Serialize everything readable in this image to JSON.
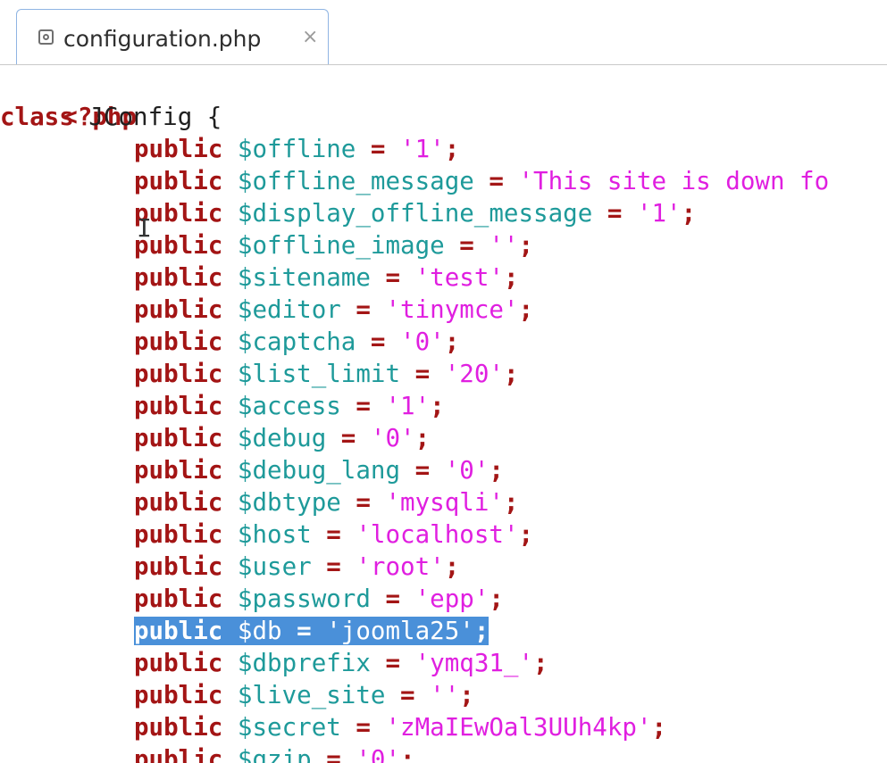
{
  "tab": {
    "title": "configuration.php",
    "close": "×"
  },
  "code": {
    "php_open": "<?php",
    "class_kw": "class",
    "class_rest": " JConfig {",
    "public_kw": "public",
    "lines": [
      {
        "var": "$offline",
        "val": "'1'"
      },
      {
        "var": "$offline_message",
        "val": "'This site is down fo"
      },
      {
        "var": "$display_offline_message",
        "val": "'1'"
      },
      {
        "var": "$offline_image",
        "val": "''"
      },
      {
        "var": "$sitename",
        "val": "'test'"
      },
      {
        "var": "$editor",
        "val": "'tinymce'"
      },
      {
        "var": "$captcha",
        "val": "'0'"
      },
      {
        "var": "$list_limit",
        "val": "'20'"
      },
      {
        "var": "$access",
        "val": "'1'"
      },
      {
        "var": "$debug",
        "val": "'0'"
      },
      {
        "var": "$debug_lang",
        "val": "'0'"
      },
      {
        "var": "$dbtype",
        "val": "'mysqli'"
      },
      {
        "var": "$host",
        "val": "'localhost'"
      },
      {
        "var": "$user",
        "val": "'root'"
      },
      {
        "var": "$password",
        "val": "'epp'"
      },
      {
        "var": "$db",
        "val": "'joomla25'",
        "selected": true
      },
      {
        "var": "$dbprefix",
        "val": "'ymq31_'"
      },
      {
        "var": "$live_site",
        "val": "''"
      },
      {
        "var": "$secret",
        "val": "'zMaIEwOal3UUh4kp'"
      },
      {
        "var": "$gzip",
        "val": "'0'"
      }
    ]
  },
  "colors": {
    "keyword": "#a31515",
    "variable": "#1e9a9a",
    "string": "#e01fe0",
    "selection": "#4a90d9"
  }
}
